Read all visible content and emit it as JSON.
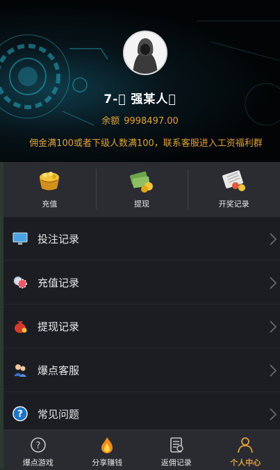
{
  "profile": {
    "username": "7-\u0000 强某人\u0000",
    "balance_label": "余额",
    "balance_value": "9998497.00",
    "notice": "佣金满100或者下级人数满100，联系客服进入工资福利群"
  },
  "quick_actions": [
    {
      "label": "充值",
      "icon": "treasure-pot-icon"
    },
    {
      "label": "提现",
      "icon": "cash-stack-icon"
    },
    {
      "label": "开奖记录",
      "icon": "lottery-ticket-icon"
    }
  ],
  "menu": [
    {
      "label": "投注记录",
      "icon": "monitor-icon"
    },
    {
      "label": "充值记录",
      "icon": "casino-chips-icon"
    },
    {
      "label": "提现记录",
      "icon": "money-bag-icon"
    },
    {
      "label": "爆点客服",
      "icon": "customer-service-icon"
    },
    {
      "label": "常见问题",
      "icon": "question-icon"
    }
  ],
  "tabbar": [
    {
      "label": "爆点游戏",
      "icon": "question-circle-icon",
      "active": false
    },
    {
      "label": "分享赚钱",
      "icon": "flame-icon",
      "active": false
    },
    {
      "label": "返佣记录",
      "icon": "document-icon",
      "active": false
    },
    {
      "label": "个人中心",
      "icon": "person-icon",
      "active": true
    }
  ],
  "colors": {
    "accent": "#e0a23a",
    "background": "#1c1d22",
    "panel": "#2b2c31"
  }
}
